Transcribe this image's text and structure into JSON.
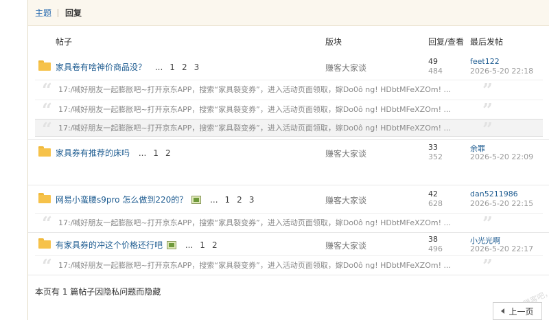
{
  "tabs": {
    "thread": "主题",
    "reply": "回复"
  },
  "columns": {
    "post": "帖子",
    "forum": "版块",
    "replies_views": "回复/查看",
    "last_post": "最后发帖"
  },
  "quote_text": "17:/喊好朋友一起膨胀吧~打开京东APP，搜索“家具裂变券”，进入活动页面领取，嫁Do0ô ng! HDbtMFeXZOm!  ...",
  "threads": [
    {
      "title": "家具卷有啥神价商品没？",
      "pages": [
        "...",
        "1",
        "2",
        "3"
      ],
      "has_image": false,
      "forum": "赚客大家谈",
      "replies": "49",
      "views": "484",
      "last_user": "feet122",
      "last_time": "2026-5-20 22:18"
    },
    {
      "title": "家具券有推荐的床吗",
      "pages": [
        "...",
        "1",
        "2"
      ],
      "has_image": false,
      "forum": "赚客大家谈",
      "replies": "33",
      "views": "352",
      "last_user": "余罪",
      "last_time": "2026-5-20 22:09"
    },
    {
      "title": "网易小蛮腰s9pro 怎么做到220的？",
      "pages": [
        "...",
        "1",
        "2",
        "3"
      ],
      "has_image": true,
      "forum": "赚客大家谈",
      "replies": "42",
      "views": "628",
      "last_user": "dan5211986",
      "last_time": "2026-5-20 22:15"
    },
    {
      "title": "有家具券的冲这个价格还行吧",
      "pages": [
        "...",
        "1",
        "2"
      ],
      "has_image": true,
      "forum": "赚客大家谈",
      "replies": "38",
      "views": "496",
      "last_user": "小光光啊",
      "last_time": "2026-5-20 22:17"
    }
  ],
  "hidden_note": "本页有 1 篇帖子因隐私问题而隐藏",
  "prev_label": "上一页",
  "watermark": "赚客吧，有奖一起赚！www.zuanke8.com"
}
